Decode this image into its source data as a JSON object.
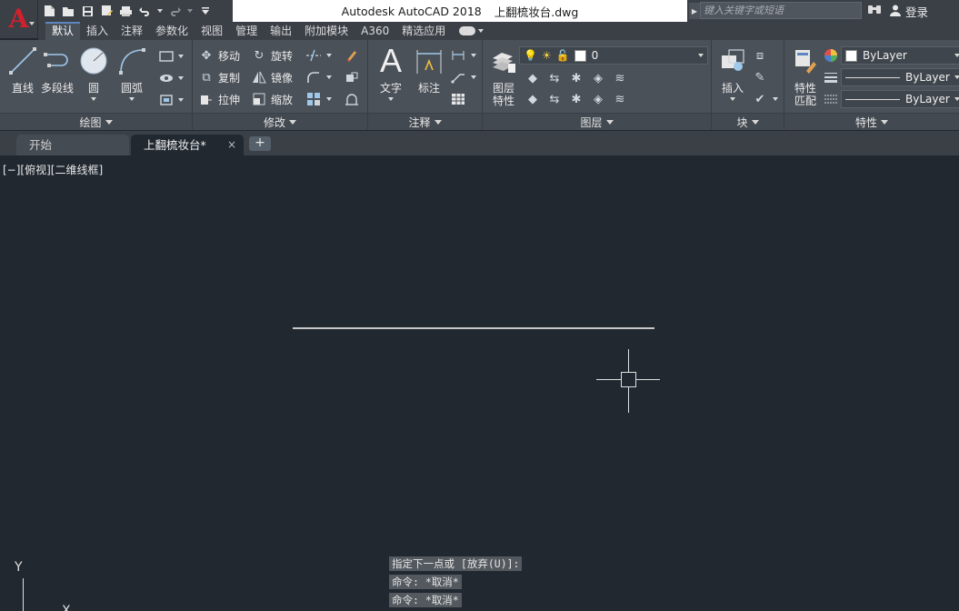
{
  "app": {
    "logo": "A",
    "product": "Autodesk AutoCAD 2018",
    "filename": "上翻梳妆台.dwg"
  },
  "search": {
    "placeholder": "键入关键字或短语"
  },
  "account": {
    "login_label": "登录"
  },
  "quick_access": [
    "new-icon",
    "open-icon",
    "save-icon",
    "saveas-icon",
    "print-icon",
    "undo-icon",
    "redo-icon",
    "customize-icon"
  ],
  "ribbon_tabs": [
    {
      "label": "默认",
      "active": true
    },
    {
      "label": "插入"
    },
    {
      "label": "注释"
    },
    {
      "label": "参数化"
    },
    {
      "label": "视图"
    },
    {
      "label": "管理"
    },
    {
      "label": "输出"
    },
    {
      "label": "附加模块"
    },
    {
      "label": "A360"
    },
    {
      "label": "精选应用"
    }
  ],
  "panels": {
    "draw": {
      "title": "绘图",
      "line": "直线",
      "polyline": "多段线",
      "circle": "圆",
      "arc": "圆弧"
    },
    "modify": {
      "title": "修改",
      "move": "移动",
      "rotate": "旋转",
      "copy": "复制",
      "mirror": "镜像",
      "stretch": "拉伸",
      "scale": "缩放"
    },
    "annotation": {
      "title": "注释",
      "text": "文字",
      "dimension": "标注"
    },
    "layers": {
      "title": "图层",
      "properties_line1": "图层",
      "properties_line2": "特性",
      "current_layer": "0"
    },
    "block": {
      "title": "块",
      "insert": "插入"
    },
    "properties": {
      "title": "特性",
      "match_line1": "特性",
      "match_line2": "匹配",
      "color": "ByLayer",
      "linetype": "ByLayer",
      "lineweight": "ByLayer"
    }
  },
  "file_tabs": [
    {
      "label": "开始",
      "active": false
    },
    {
      "label": "上翻梳妆台*",
      "active": true,
      "close": "×"
    }
  ],
  "new_tab_label": "+",
  "viewport": {
    "label": "[−][俯视][二维线框]"
  },
  "command_history": [
    "指定下一点或 [放弃(U)]:",
    "命令: *取消*",
    "命令: *取消*"
  ],
  "ucs": {
    "y_label": "Y",
    "x_label": "X"
  },
  "colors": {
    "canvas_bg": "#212830",
    "ribbon_bg": "#4b5159",
    "logo_red": "#d4202c",
    "active_tab_accent": "#5c86c0"
  }
}
